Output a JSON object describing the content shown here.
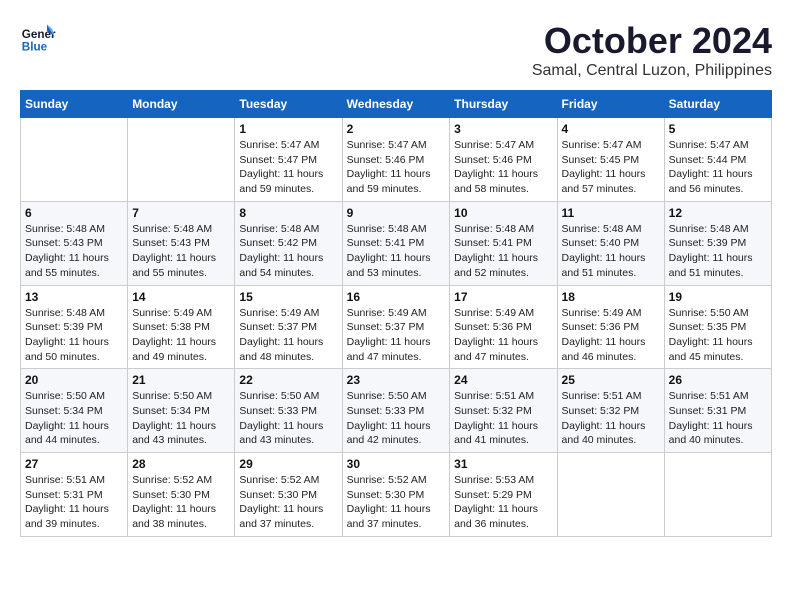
{
  "header": {
    "logo_line1": "General",
    "logo_line2": "Blue",
    "month": "October 2024",
    "location": "Samal, Central Luzon, Philippines"
  },
  "weekdays": [
    "Sunday",
    "Monday",
    "Tuesday",
    "Wednesday",
    "Thursday",
    "Friday",
    "Saturday"
  ],
  "weeks": [
    [
      {
        "day": null,
        "info": null
      },
      {
        "day": null,
        "info": null
      },
      {
        "day": "1",
        "info": "Sunrise: 5:47 AM\nSunset: 5:47 PM\nDaylight: 11 hours\nand 59 minutes."
      },
      {
        "day": "2",
        "info": "Sunrise: 5:47 AM\nSunset: 5:46 PM\nDaylight: 11 hours\nand 59 minutes."
      },
      {
        "day": "3",
        "info": "Sunrise: 5:47 AM\nSunset: 5:46 PM\nDaylight: 11 hours\nand 58 minutes."
      },
      {
        "day": "4",
        "info": "Sunrise: 5:47 AM\nSunset: 5:45 PM\nDaylight: 11 hours\nand 57 minutes."
      },
      {
        "day": "5",
        "info": "Sunrise: 5:47 AM\nSunset: 5:44 PM\nDaylight: 11 hours\nand 56 minutes."
      }
    ],
    [
      {
        "day": "6",
        "info": "Sunrise: 5:48 AM\nSunset: 5:43 PM\nDaylight: 11 hours\nand 55 minutes."
      },
      {
        "day": "7",
        "info": "Sunrise: 5:48 AM\nSunset: 5:43 PM\nDaylight: 11 hours\nand 55 minutes."
      },
      {
        "day": "8",
        "info": "Sunrise: 5:48 AM\nSunset: 5:42 PM\nDaylight: 11 hours\nand 54 minutes."
      },
      {
        "day": "9",
        "info": "Sunrise: 5:48 AM\nSunset: 5:41 PM\nDaylight: 11 hours\nand 53 minutes."
      },
      {
        "day": "10",
        "info": "Sunrise: 5:48 AM\nSunset: 5:41 PM\nDaylight: 11 hours\nand 52 minutes."
      },
      {
        "day": "11",
        "info": "Sunrise: 5:48 AM\nSunset: 5:40 PM\nDaylight: 11 hours\nand 51 minutes."
      },
      {
        "day": "12",
        "info": "Sunrise: 5:48 AM\nSunset: 5:39 PM\nDaylight: 11 hours\nand 51 minutes."
      }
    ],
    [
      {
        "day": "13",
        "info": "Sunrise: 5:48 AM\nSunset: 5:39 PM\nDaylight: 11 hours\nand 50 minutes."
      },
      {
        "day": "14",
        "info": "Sunrise: 5:49 AM\nSunset: 5:38 PM\nDaylight: 11 hours\nand 49 minutes."
      },
      {
        "day": "15",
        "info": "Sunrise: 5:49 AM\nSunset: 5:37 PM\nDaylight: 11 hours\nand 48 minutes."
      },
      {
        "day": "16",
        "info": "Sunrise: 5:49 AM\nSunset: 5:37 PM\nDaylight: 11 hours\nand 47 minutes."
      },
      {
        "day": "17",
        "info": "Sunrise: 5:49 AM\nSunset: 5:36 PM\nDaylight: 11 hours\nand 47 minutes."
      },
      {
        "day": "18",
        "info": "Sunrise: 5:49 AM\nSunset: 5:36 PM\nDaylight: 11 hours\nand 46 minutes."
      },
      {
        "day": "19",
        "info": "Sunrise: 5:50 AM\nSunset: 5:35 PM\nDaylight: 11 hours\nand 45 minutes."
      }
    ],
    [
      {
        "day": "20",
        "info": "Sunrise: 5:50 AM\nSunset: 5:34 PM\nDaylight: 11 hours\nand 44 minutes."
      },
      {
        "day": "21",
        "info": "Sunrise: 5:50 AM\nSunset: 5:34 PM\nDaylight: 11 hours\nand 43 minutes."
      },
      {
        "day": "22",
        "info": "Sunrise: 5:50 AM\nSunset: 5:33 PM\nDaylight: 11 hours\nand 43 minutes."
      },
      {
        "day": "23",
        "info": "Sunrise: 5:50 AM\nSunset: 5:33 PM\nDaylight: 11 hours\nand 42 minutes."
      },
      {
        "day": "24",
        "info": "Sunrise: 5:51 AM\nSunset: 5:32 PM\nDaylight: 11 hours\nand 41 minutes."
      },
      {
        "day": "25",
        "info": "Sunrise: 5:51 AM\nSunset: 5:32 PM\nDaylight: 11 hours\nand 40 minutes."
      },
      {
        "day": "26",
        "info": "Sunrise: 5:51 AM\nSunset: 5:31 PM\nDaylight: 11 hours\nand 40 minutes."
      }
    ],
    [
      {
        "day": "27",
        "info": "Sunrise: 5:51 AM\nSunset: 5:31 PM\nDaylight: 11 hours\nand 39 minutes."
      },
      {
        "day": "28",
        "info": "Sunrise: 5:52 AM\nSunset: 5:30 PM\nDaylight: 11 hours\nand 38 minutes."
      },
      {
        "day": "29",
        "info": "Sunrise: 5:52 AM\nSunset: 5:30 PM\nDaylight: 11 hours\nand 37 minutes."
      },
      {
        "day": "30",
        "info": "Sunrise: 5:52 AM\nSunset: 5:30 PM\nDaylight: 11 hours\nand 37 minutes."
      },
      {
        "day": "31",
        "info": "Sunrise: 5:53 AM\nSunset: 5:29 PM\nDaylight: 11 hours\nand 36 minutes."
      },
      {
        "day": null,
        "info": null
      },
      {
        "day": null,
        "info": null
      }
    ]
  ]
}
